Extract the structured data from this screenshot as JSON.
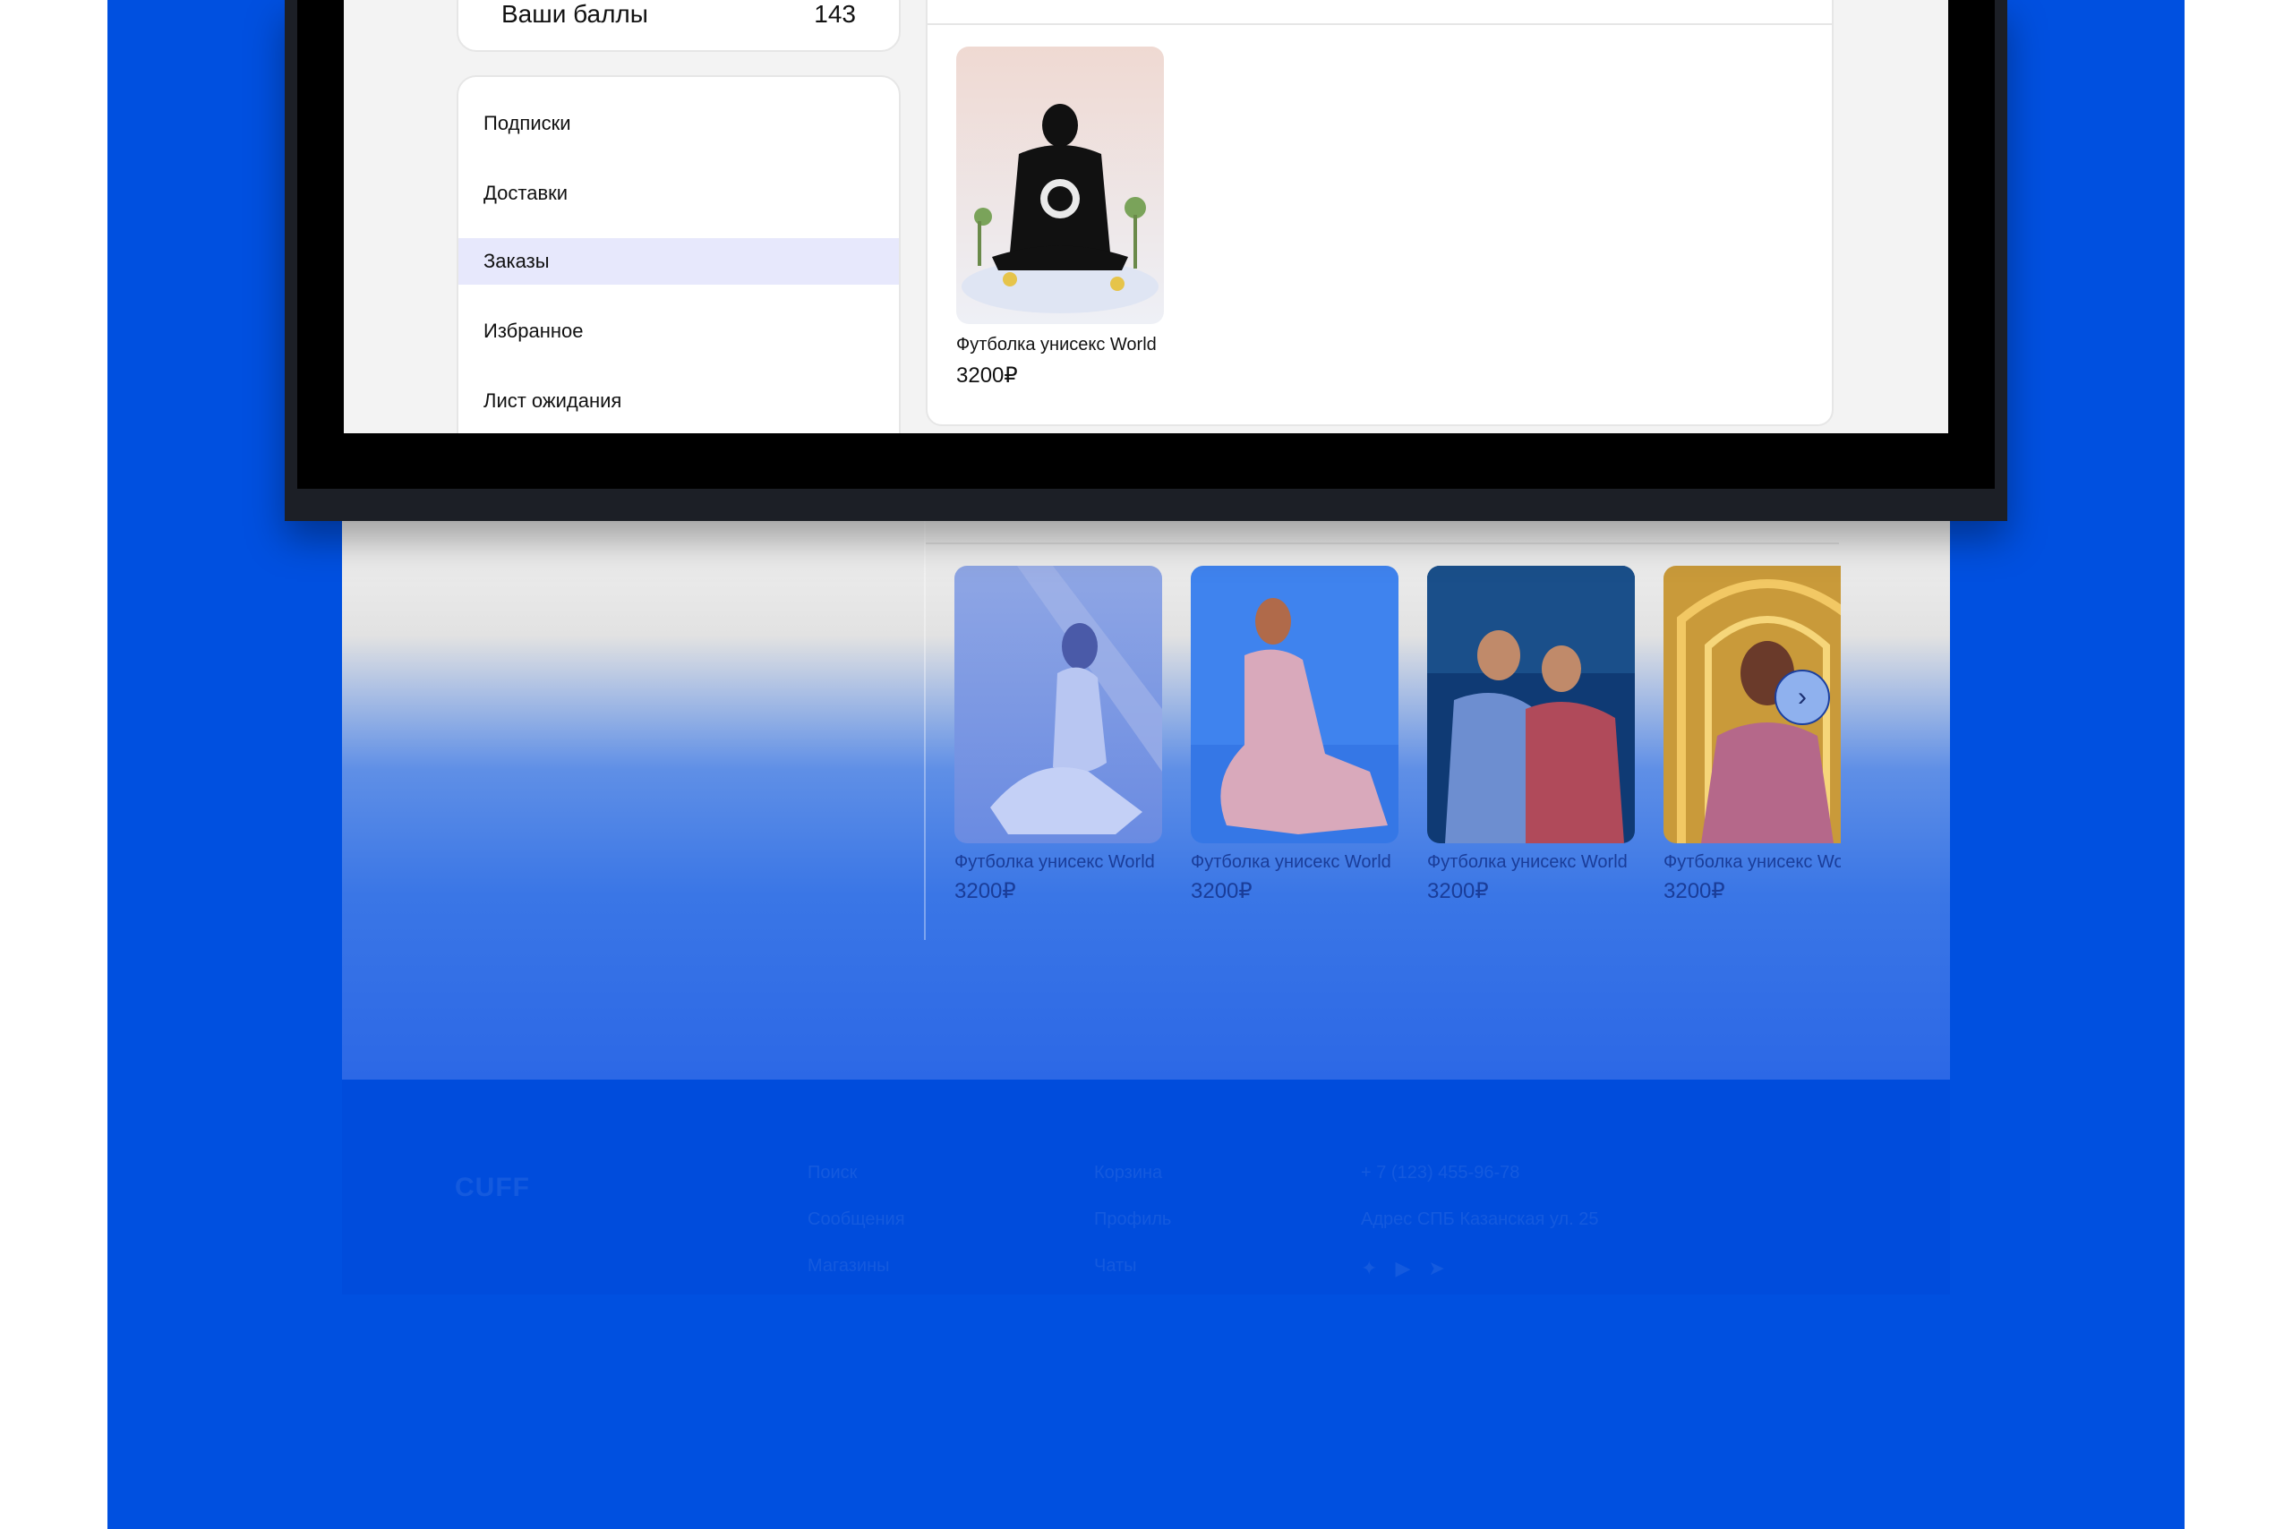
{
  "account": {
    "points_label": "Ваши баллы",
    "points_value": "143"
  },
  "nav": {
    "items": [
      {
        "label": "Подписки",
        "active": false
      },
      {
        "label": "Доставки",
        "active": false
      },
      {
        "label": "Заказы",
        "active": true
      },
      {
        "label": "Избранное",
        "active": false
      },
      {
        "label": "Лист ожидания",
        "active": false
      }
    ]
  },
  "orders": {
    "items": [
      {
        "name": "Футболка унисекс World",
        "price": "3200₽"
      }
    ]
  },
  "recommendations": {
    "items": [
      {
        "name": "Футболка унисекс World",
        "price": "3200₽"
      },
      {
        "name": "Футболка унисекс World",
        "price": "3200₽"
      },
      {
        "name": "Футболка унисекс World",
        "price": "3200₽"
      },
      {
        "name": "Футболка унисекс World",
        "price": "3200₽"
      }
    ],
    "next_icon": "chevron-right-icon"
  },
  "footer": {
    "logo": "CUFF",
    "col1": [
      "Поиск",
      "Сообщения",
      "Магазины"
    ],
    "col2": [
      "Корзина",
      "Профиль",
      "Чаты"
    ],
    "phone": "+ 7 (123) 455-96-78",
    "address": "Адрес СПБ Казанская ул. 25",
    "socials": [
      "vk-icon",
      "youtube-icon",
      "telegram-icon"
    ]
  },
  "colors": {
    "background_blue": "#0050e0",
    "active_nav": "#e7e8fc"
  }
}
